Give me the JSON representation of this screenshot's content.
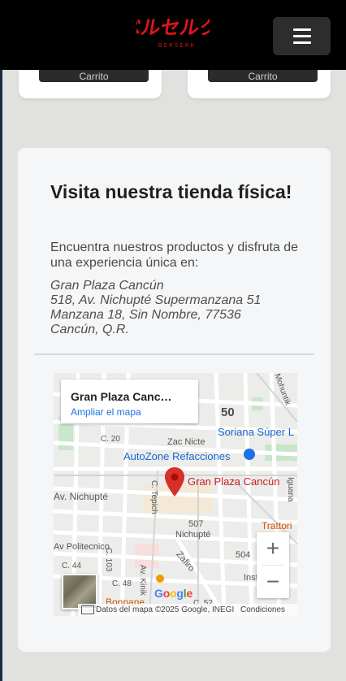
{
  "header": {
    "logo_text": "ベルセルク",
    "logo_sub": "BERSERK",
    "menu_icon": "hamburger-menu-icon"
  },
  "products": {
    "cart_label": "Carrito"
  },
  "store": {
    "title": "Visita nuestra tienda física!",
    "description": "Encuentra nuestros productos y disfruta de una experiencia única en:",
    "address": [
      "Gran Plaza Cancún",
      "518, Av. Nichupté Supermanzana 51",
      "Manzana 18, Sin Nombre, 77536",
      "Cancún, Q.R."
    ]
  },
  "map": {
    "card_place": "Gran Plaza Canc…",
    "card_link": "Ampliar el mapa",
    "pin_label": "Gran Plaza Cancún",
    "labels": {
      "n50": "50",
      "soriana": "Soriana Súper L",
      "autozone": "AutoZone Refacciones",
      "zac_nicte": "Zac Nicte",
      "c20": "C. 20",
      "av_nichupte": "Av. Nichupté",
      "c_tepich": "C. Tepich",
      "n507": "507",
      "nichupte": "Nichupté",
      "av_politecnico": "Av Politecnico",
      "c44": "C. 44",
      "c103": "C. 103",
      "c48": "C. 48",
      "av_kinik": "Av. Kinik",
      "zafiro": "Zafiro",
      "n504": "504",
      "iguana": "Iguana",
      "trattoria": "Trattori",
      "bonpane": "Bonpane",
      "inst": "Inst",
      "mohuntik": "Mohuntik",
      "c52": "C. 52"
    },
    "zoom_in": "+",
    "zoom_out": "−",
    "google": "Google",
    "attribution": "Datos del mapa ©2025 Google, INEGI",
    "terms": "Condiciones",
    "colors": {
      "pin": "#d93025",
      "poi_blue": "#1967d2",
      "park": "#c8e6c9",
      "road": "#ffffff",
      "block": "#eeeeec"
    }
  },
  "colors": {
    "page_bg": "#e1e2df",
    "header_bg": "#000000",
    "logo_red": "#e5141b",
    "card_bg": "#f5f6f8"
  }
}
